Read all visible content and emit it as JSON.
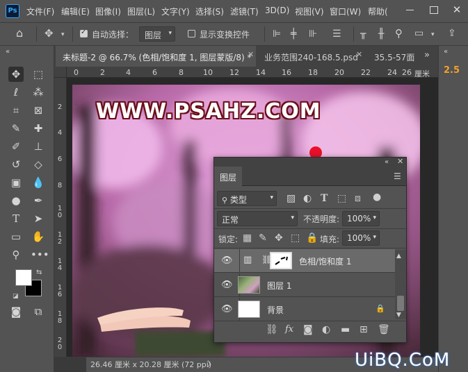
{
  "app": {
    "logo": "Ps"
  },
  "menu": [
    "文件(F)",
    "编辑(E)",
    "图像(I)",
    "图层(L)",
    "文字(Y)",
    "选择(S)",
    "滤镜(T)",
    "3D(D)",
    "视图(V)",
    "窗口(W)",
    "帮助("
  ],
  "options": {
    "auto_select_label": "自动选择：",
    "auto_select_checked": true,
    "auto_select_target": "图层",
    "show_transform_label": "显示变换控件",
    "show_transform_checked": false
  },
  "tabs": [
    {
      "label": "未标题-2 @ 66.7% (色相/饱和度 1, 图层蒙版/8) *",
      "active": true
    },
    {
      "label": "业务范围240-168.5.psd",
      "active": false
    },
    {
      "label": "35.5-57面",
      "active": false
    }
  ],
  "ruler": {
    "h": [
      "0",
      "2",
      "4",
      "6",
      "8",
      "10",
      "12",
      "14",
      "16",
      "18",
      "20",
      "22",
      "24",
      "26"
    ],
    "h_unit": "厘米",
    "v": [
      "2",
      "4",
      "6",
      "8",
      "1 0",
      "1 2",
      "1 4",
      "1 6",
      "1 8",
      "2 0"
    ]
  },
  "canvas": {
    "watermark": "WWW.PSAHZ.COM"
  },
  "status": {
    "doc_size": "26.46 厘米 x 20.28 厘米 (72 ppi)",
    "arrow": "〉"
  },
  "right_panel": {
    "value": "2.5"
  },
  "layers_panel": {
    "tab_label": "图层",
    "filter_label": "类型",
    "blend_mode": "正常",
    "opacity_label": "不透明度:",
    "opacity_value": "100%",
    "lock_label": "锁定:",
    "fill_label": "填充:",
    "fill_value": "100%",
    "layers": [
      {
        "name": "色相/饱和度 1",
        "kind": "adjustment",
        "selected": true
      },
      {
        "name": "图层 1",
        "kind": "image",
        "selected": false
      },
      {
        "name": "背景",
        "kind": "background",
        "selected": false,
        "locked": true
      }
    ],
    "bottom_icons": [
      "link-icon",
      "fx-icon",
      "mask-icon",
      "adjustment-icon",
      "group-icon",
      "new-layer-icon",
      "delete-icon"
    ],
    "fx_label": "fx"
  },
  "site_watermark": "UiBQ.CoM",
  "colors": {
    "accent": "#f0a030",
    "panel_bg": "#535353",
    "dark_bg": "#424242",
    "watermark_stroke": "#6a0f18"
  }
}
